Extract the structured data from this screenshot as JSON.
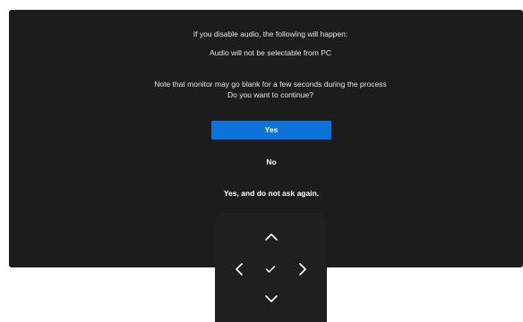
{
  "dialog": {
    "line1": "If you disable audio, the following will happen:",
    "line2": "Audio will not be selectable from PC",
    "line3": "Note that monitor may go blank for a few seconds during the process",
    "line4": "Do you want to continue?"
  },
  "buttons": {
    "yes": "Yes",
    "no": "No",
    "yes_never_ask": "Yes, and do not ask again."
  },
  "joystick": {
    "icons": [
      "chevron-up-icon",
      "chevron-left-icon",
      "checkmark-icon",
      "chevron-right-icon",
      "chevron-down-icon"
    ]
  },
  "colors": {
    "panel": "#1c1c1c",
    "accent": "#0b73d9",
    "text": "#e6e6e6"
  }
}
